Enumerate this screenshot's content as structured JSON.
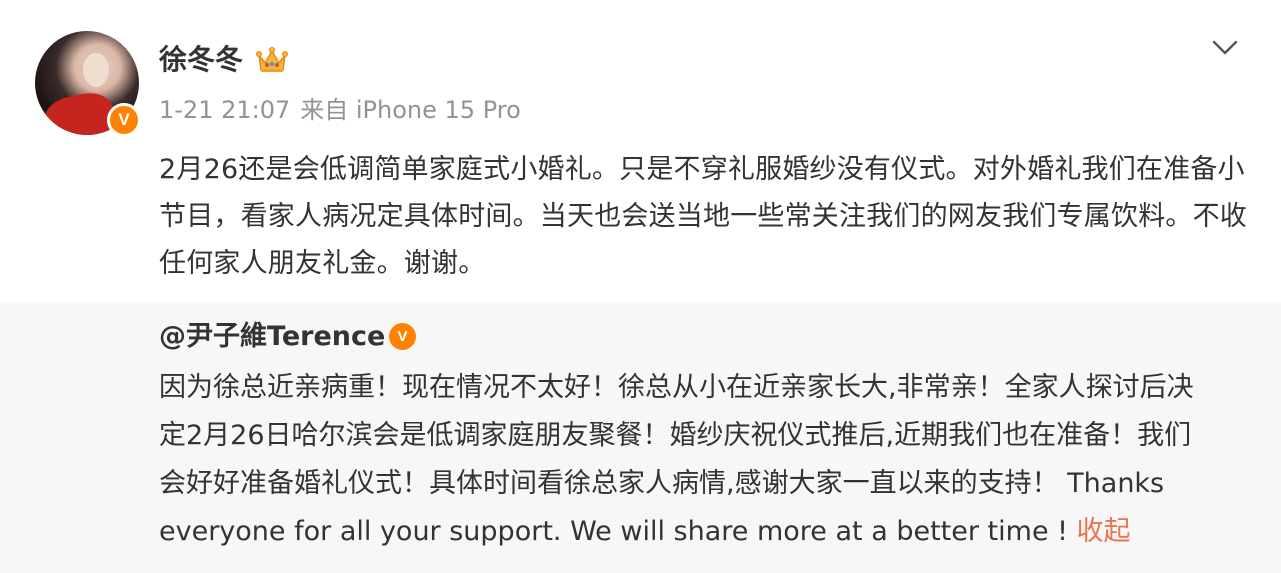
{
  "post": {
    "author": "徐冬冬",
    "avatar_badge": "V",
    "timestamp": "1-21 21:07",
    "source": "来自 iPhone 15 Pro",
    "text": "2月26还是会低调简单家庭式小婚礼。只是不穿礼服婚纱没有仪式。对外婚礼我们在准备小节目，看家人病况定具体时间。当天也会送当地一些常关注我们的网友我们专属饮料。不收任何家人朋友礼金。谢谢。",
    "icons": [
      "crown-icon",
      "chevron-down-icon",
      "verified-icon"
    ]
  },
  "repost": {
    "author": "@尹子維Terence",
    "author_badge": "V",
    "lines": [
      "因为徐总近亲病重！现在情况不太好！徐总从小在近亲家长大,非常亲！全家人探讨后决",
      "定2月26日哈尔滨会是低调家庭朋友聚餐！婚纱庆祝仪式推后,近期我们也在准备！我们",
      "会好好准备婚礼仪式！具体时间看徐总家人病情,感谢大家一直以来的支持！ Thanks",
      "everyone for all your support.  We will share more at a better time ! "
    ],
    "collapse_label": "收起"
  },
  "colors": {
    "accent": "#eb7350",
    "verified": "#ff8200",
    "repost_bg": "#f7f7f7",
    "meta_text": "#939393"
  }
}
